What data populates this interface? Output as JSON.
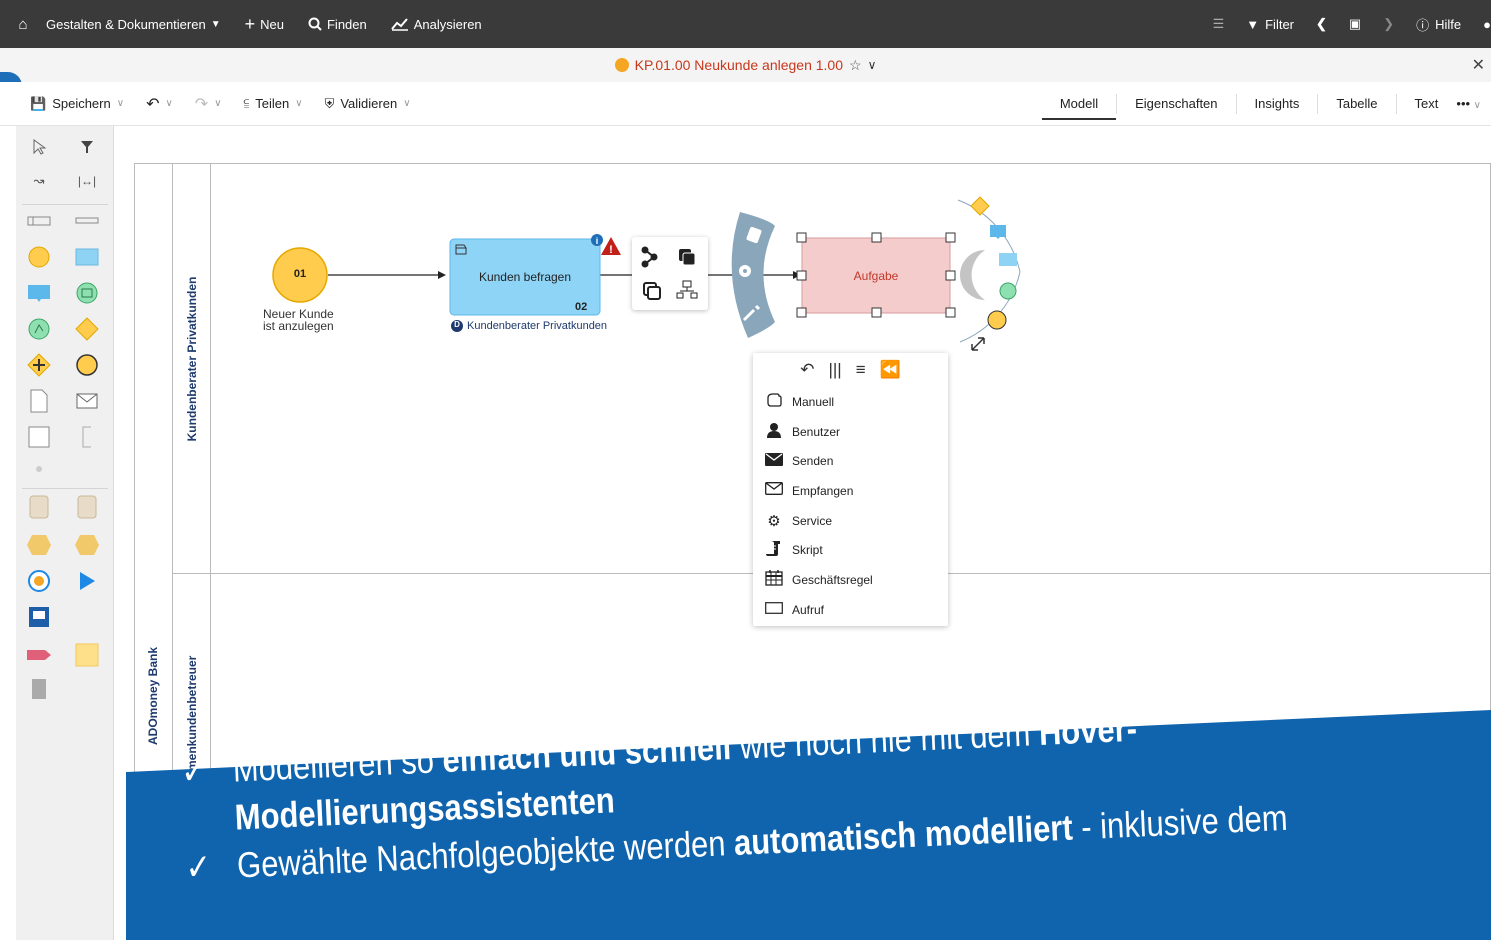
{
  "topnav": {
    "items": [
      {
        "label": "Gestalten & Dokumentieren",
        "icon": "chevron-down"
      },
      {
        "label": "Neu",
        "icon": "plus"
      },
      {
        "label": "Finden",
        "icon": "search"
      },
      {
        "label": "Analysieren",
        "icon": "chart"
      }
    ],
    "filter_label": "Filter",
    "help_label": "Hilfe"
  },
  "titlebar": {
    "title": "KP.01.00 Neukunde anlegen 1.00"
  },
  "toolbar": {
    "save": "Speichern",
    "share": "Teilen",
    "validate": "Validieren",
    "tabs": [
      "Modell",
      "Eigenschaften",
      "Insights",
      "Tabelle",
      "Text"
    ],
    "active_tab": "Modell",
    "more": "•••"
  },
  "diagram": {
    "pool_name": "ADOmoney Bank",
    "lane1_name": "Kundenberater Privatkunden",
    "lane2_name": "Firmenkundenbetreuer",
    "start_event": {
      "number": "01",
      "label_line1": "Neuer Kunde",
      "label_line2": "ist anzulegen"
    },
    "task1": {
      "name": "Kunden befragen",
      "number": "02",
      "performer_badge": "D",
      "performer": "Kundenberater Privatkunden"
    },
    "task2": {
      "name": "Aufgabe"
    }
  },
  "popup": {
    "items": [
      {
        "label": "Manuell",
        "icon": "hand-icon"
      },
      {
        "label": "Benutzer",
        "icon": "user-icon"
      },
      {
        "label": "Senden",
        "icon": "envelope-filled-icon"
      },
      {
        "label": "Empfangen",
        "icon": "envelope-outline-icon"
      },
      {
        "label": "Service",
        "icon": "gears-icon"
      },
      {
        "label": "Skript",
        "icon": "script-icon"
      },
      {
        "label": "Geschäftsregel",
        "icon": "calendar-table-icon"
      },
      {
        "label": "Aufruf",
        "icon": "rectangle-icon"
      }
    ]
  },
  "banner": {
    "check": "✓",
    "line1_a": "Modellieren so ",
    "line1_b": "einfach und schnell",
    "line1_c": " wie noch nie mit dem ",
    "line1_d": "Hover-",
    "line2": "Modellierungsassistenten",
    "line3_a": "Gewählte Nachfolgeobjekte werden ",
    "line3_b": "automatisch modelliert",
    "line3_c": " - inklusive dem",
    "color": "#0f64ad"
  }
}
